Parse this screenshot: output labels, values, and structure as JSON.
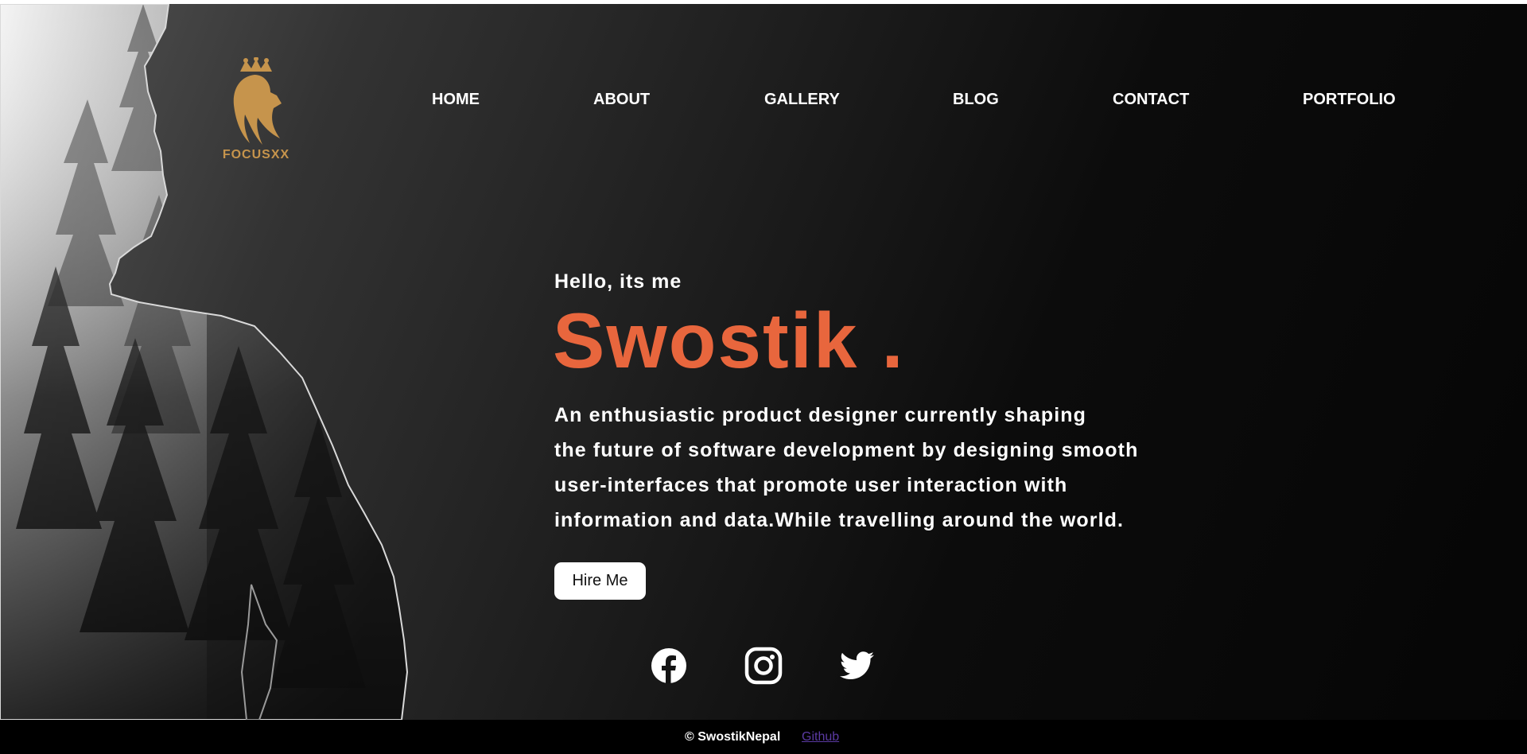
{
  "brand": {
    "name": "FOCUSXX",
    "logo_icon": "lion-crown-icon",
    "color": "#c6944c"
  },
  "nav": {
    "items": [
      {
        "label": "HOME"
      },
      {
        "label": "ABOUT"
      },
      {
        "label": "GALLERY"
      },
      {
        "label": "BLOG"
      },
      {
        "label": "CONTACT"
      },
      {
        "label": "PORTFOLIO"
      }
    ]
  },
  "hero": {
    "greeting": "Hello, its me",
    "name": "Swostik .",
    "bio_lines": [
      "An enthusiastic product designer currently shaping",
      "the future of software development by designing smooth",
      "user-interfaces that promote user interaction with",
      "information and data.While travelling around the world."
    ],
    "cta_label": "Hire Me",
    "accent_color": "#e8663d"
  },
  "social": [
    {
      "icon": "facebook-icon"
    },
    {
      "icon": "instagram-icon"
    },
    {
      "icon": "twitter-icon"
    }
  ],
  "footer": {
    "copyright": "© SwostikNepal",
    "github_label": "Github",
    "link_color": "#5b3aa3"
  }
}
